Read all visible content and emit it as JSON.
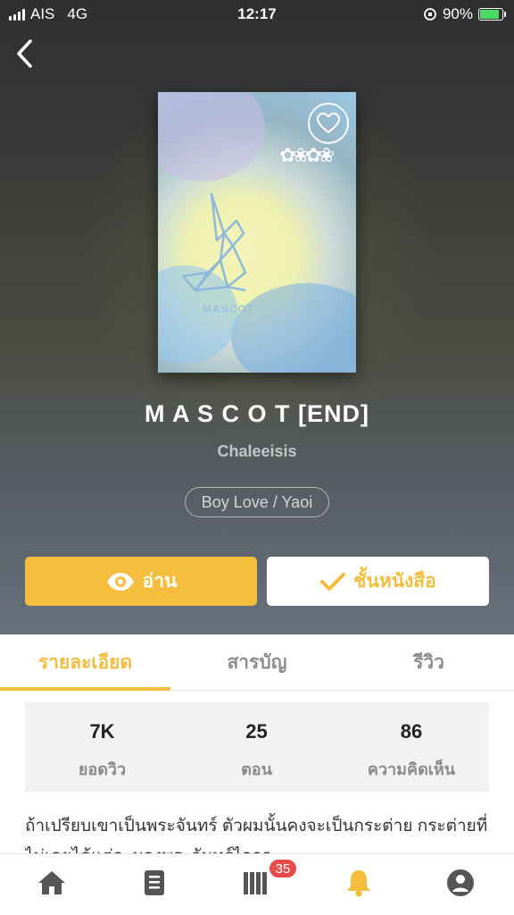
{
  "status_bar": {
    "carrier": "AIS",
    "network": "4G",
    "time": "12:17",
    "battery": "90%",
    "battery_level": 0.9
  },
  "book": {
    "cover_text": "MASCOT",
    "title": "M A S C O T [END]",
    "author": "Chaleeisis",
    "tag": "Boy Love / Yaoi"
  },
  "actions": {
    "read_label": "อ่าน",
    "shelf_label": "ชั้นหนังสือ"
  },
  "tabs": [
    {
      "label": "รายละเอียด",
      "active": true
    },
    {
      "label": "สารบัญ",
      "active": false
    },
    {
      "label": "รีวิว",
      "active": false
    }
  ],
  "stats": [
    {
      "value": "7K",
      "label": "ยอดวิว"
    },
    {
      "value": "25",
      "label": "ตอน"
    },
    {
      "value": "86",
      "label": "ความคิดเห็น"
    }
  ],
  "description": "ถ้าเปรียบเขาเป็นพระจันทร์ ตัวผมนั้นคงจะเป็นกระต่าย กระต่ายที่ไม่เคยได้แต่จะมองพระจันทร์ไกลๆ",
  "bottom_nav": {
    "items": [
      {
        "icon": "home-icon"
      },
      {
        "icon": "book-icon"
      },
      {
        "icon": "library-icon",
        "badge": "35"
      },
      {
        "icon": "bell-icon",
        "active": true
      },
      {
        "icon": "profile-icon"
      }
    ]
  },
  "colors": {
    "accent": "#f5bd3c",
    "badge": "#e74c4c",
    "inactive": "#555555"
  }
}
